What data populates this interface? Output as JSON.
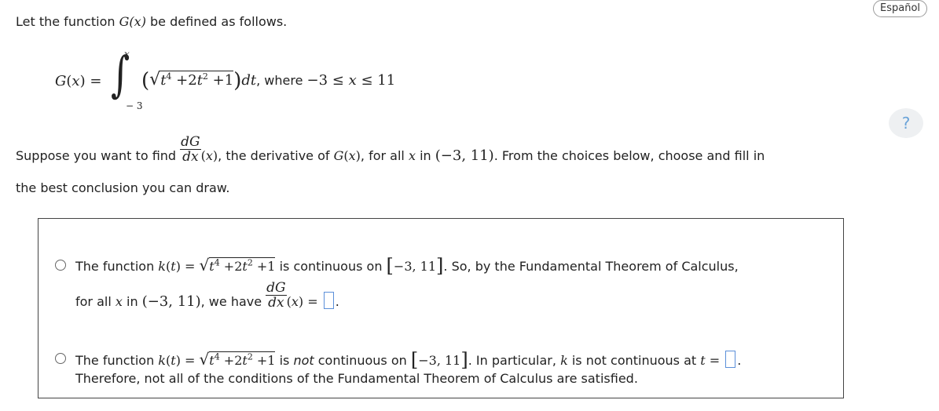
{
  "language_button": "Español",
  "help_button": "?",
  "intro": {
    "part1": "Let the function ",
    "part2": " be defined as follows."
  },
  "definition": {
    "lhs": "G(x) =",
    "upper_limit": "x",
    "lower_limit": "− 3",
    "where": "where",
    "domain": "−3 ≤ x ≤ 11"
  },
  "question": {
    "part1": "Suppose you want to find",
    "part2": ", the derivative of",
    "part3": ", for all",
    "part4": "in",
    "interval": "(−3, 11)",
    "part5": ". From the choices below, choose and fill in",
    "line2": "the best conclusion you can draw."
  },
  "choice1": {
    "line1_a": "The function",
    "line1_b": "is continuous on",
    "closed_interval": "−3, 11",
    "line1_c": ". So, by the Fundamental Theorem of Calculus,",
    "line2_a": "for all",
    "line2_b": "in",
    "line2_c": ", we have"
  },
  "choice2": {
    "line1_a": "The function",
    "line1_b": "is",
    "not_word": "not",
    "line1_c": "continuous on",
    "closed_interval": "−3, 11",
    "line1_d": ". In particular,",
    "line1_e": "is not continuous at",
    "line2": "Therefore, not all of the conditions of the Fundamental Theorem of Calculus are satisfied."
  },
  "math": {
    "G": "G",
    "x": "x",
    "t": "t",
    "k": "k",
    "dG": "dG",
    "dx": "dx",
    "dt": "dt",
    "k_of_t": "k(t) =",
    "t_eq": "t ="
  },
  "colors": {
    "answer_box_border": "#5b8fd9",
    "help_icon": "#6aa3d8"
  }
}
